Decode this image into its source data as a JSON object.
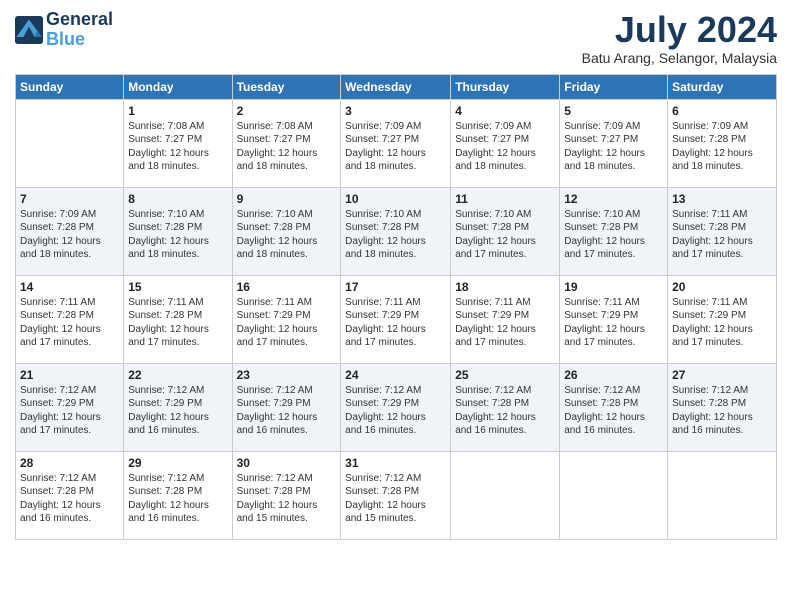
{
  "logo": {
    "line1": "General",
    "line2": "Blue"
  },
  "title": "July 2024",
  "location": "Batu Arang, Selangor, Malaysia",
  "days_of_week": [
    "Sunday",
    "Monday",
    "Tuesday",
    "Wednesday",
    "Thursday",
    "Friday",
    "Saturday"
  ],
  "weeks": [
    [
      {
        "day": "",
        "info": ""
      },
      {
        "day": "1",
        "info": "Sunrise: 7:08 AM\nSunset: 7:27 PM\nDaylight: 12 hours\nand 18 minutes."
      },
      {
        "day": "2",
        "info": "Sunrise: 7:08 AM\nSunset: 7:27 PM\nDaylight: 12 hours\nand 18 minutes."
      },
      {
        "day": "3",
        "info": "Sunrise: 7:09 AM\nSunset: 7:27 PM\nDaylight: 12 hours\nand 18 minutes."
      },
      {
        "day": "4",
        "info": "Sunrise: 7:09 AM\nSunset: 7:27 PM\nDaylight: 12 hours\nand 18 minutes."
      },
      {
        "day": "5",
        "info": "Sunrise: 7:09 AM\nSunset: 7:27 PM\nDaylight: 12 hours\nand 18 minutes."
      },
      {
        "day": "6",
        "info": "Sunrise: 7:09 AM\nSunset: 7:28 PM\nDaylight: 12 hours\nand 18 minutes."
      }
    ],
    [
      {
        "day": "7",
        "info": "Sunrise: 7:09 AM\nSunset: 7:28 PM\nDaylight: 12 hours\nand 18 minutes."
      },
      {
        "day": "8",
        "info": "Sunrise: 7:10 AM\nSunset: 7:28 PM\nDaylight: 12 hours\nand 18 minutes."
      },
      {
        "day": "9",
        "info": "Sunrise: 7:10 AM\nSunset: 7:28 PM\nDaylight: 12 hours\nand 18 minutes."
      },
      {
        "day": "10",
        "info": "Sunrise: 7:10 AM\nSunset: 7:28 PM\nDaylight: 12 hours\nand 18 minutes."
      },
      {
        "day": "11",
        "info": "Sunrise: 7:10 AM\nSunset: 7:28 PM\nDaylight: 12 hours\nand 17 minutes."
      },
      {
        "day": "12",
        "info": "Sunrise: 7:10 AM\nSunset: 7:28 PM\nDaylight: 12 hours\nand 17 minutes."
      },
      {
        "day": "13",
        "info": "Sunrise: 7:11 AM\nSunset: 7:28 PM\nDaylight: 12 hours\nand 17 minutes."
      }
    ],
    [
      {
        "day": "14",
        "info": "Sunrise: 7:11 AM\nSunset: 7:28 PM\nDaylight: 12 hours\nand 17 minutes."
      },
      {
        "day": "15",
        "info": "Sunrise: 7:11 AM\nSunset: 7:28 PM\nDaylight: 12 hours\nand 17 minutes."
      },
      {
        "day": "16",
        "info": "Sunrise: 7:11 AM\nSunset: 7:29 PM\nDaylight: 12 hours\nand 17 minutes."
      },
      {
        "day": "17",
        "info": "Sunrise: 7:11 AM\nSunset: 7:29 PM\nDaylight: 12 hours\nand 17 minutes."
      },
      {
        "day": "18",
        "info": "Sunrise: 7:11 AM\nSunset: 7:29 PM\nDaylight: 12 hours\nand 17 minutes."
      },
      {
        "day": "19",
        "info": "Sunrise: 7:11 AM\nSunset: 7:29 PM\nDaylight: 12 hours\nand 17 minutes."
      },
      {
        "day": "20",
        "info": "Sunrise: 7:11 AM\nSunset: 7:29 PM\nDaylight: 12 hours\nand 17 minutes."
      }
    ],
    [
      {
        "day": "21",
        "info": "Sunrise: 7:12 AM\nSunset: 7:29 PM\nDaylight: 12 hours\nand 17 minutes."
      },
      {
        "day": "22",
        "info": "Sunrise: 7:12 AM\nSunset: 7:29 PM\nDaylight: 12 hours\nand 16 minutes."
      },
      {
        "day": "23",
        "info": "Sunrise: 7:12 AM\nSunset: 7:29 PM\nDaylight: 12 hours\nand 16 minutes."
      },
      {
        "day": "24",
        "info": "Sunrise: 7:12 AM\nSunset: 7:29 PM\nDaylight: 12 hours\nand 16 minutes."
      },
      {
        "day": "25",
        "info": "Sunrise: 7:12 AM\nSunset: 7:28 PM\nDaylight: 12 hours\nand 16 minutes."
      },
      {
        "day": "26",
        "info": "Sunrise: 7:12 AM\nSunset: 7:28 PM\nDaylight: 12 hours\nand 16 minutes."
      },
      {
        "day": "27",
        "info": "Sunrise: 7:12 AM\nSunset: 7:28 PM\nDaylight: 12 hours\nand 16 minutes."
      }
    ],
    [
      {
        "day": "28",
        "info": "Sunrise: 7:12 AM\nSunset: 7:28 PM\nDaylight: 12 hours\nand 16 minutes."
      },
      {
        "day": "29",
        "info": "Sunrise: 7:12 AM\nSunset: 7:28 PM\nDaylight: 12 hours\nand 16 minutes."
      },
      {
        "day": "30",
        "info": "Sunrise: 7:12 AM\nSunset: 7:28 PM\nDaylight: 12 hours\nand 15 minutes."
      },
      {
        "day": "31",
        "info": "Sunrise: 7:12 AM\nSunset: 7:28 PM\nDaylight: 12 hours\nand 15 minutes."
      },
      {
        "day": "",
        "info": ""
      },
      {
        "day": "",
        "info": ""
      },
      {
        "day": "",
        "info": ""
      }
    ]
  ]
}
